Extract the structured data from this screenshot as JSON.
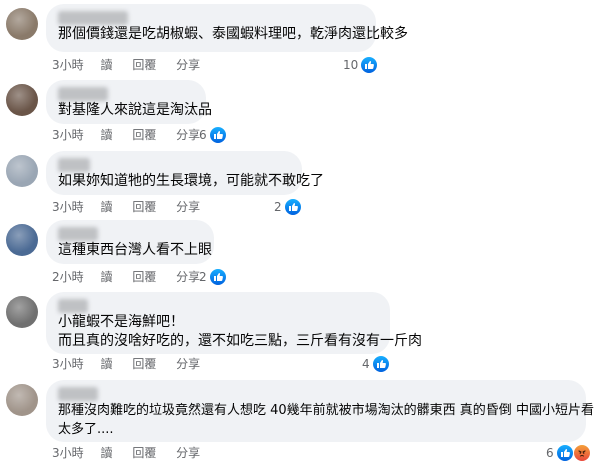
{
  "colors": {
    "bubble": "#f0f2f5",
    "meta_text": "#65676b",
    "body_text": "#050505",
    "like_blue": "#1877f2",
    "angry_orange": "#f0742f"
  },
  "actions": {
    "reply": "讀",
    "hide": "回覆",
    "share": "分享"
  },
  "comments": [
    {
      "avatar_color": "#8a7a6a",
      "time": "3小時",
      "text_lines": [
        "那個價錢還是吃胡椒蝦、泰國蝦料理吧，乾淨肉還比較多"
      ],
      "reactions": {
        "count": "10",
        "icons": [
          "like-icon"
        ]
      }
    },
    {
      "avatar_color": "#6a5548",
      "time": "3小時",
      "text_lines": [
        "對基隆人來說這是淘汰品"
      ],
      "reactions": {
        "count": "6",
        "icons": [
          "like-icon"
        ]
      }
    },
    {
      "avatar_color": "#9aa6b4",
      "time": "3小時",
      "text_lines": [
        "如果妳知道牠的生長環境，可能就不敢吃了"
      ],
      "reactions": {
        "count": "2",
        "icons": [
          "like-icon"
        ]
      }
    },
    {
      "avatar_color": "#4b6a94",
      "time": "2小時",
      "text_lines": [
        "這種東西台灣人看不上眼"
      ],
      "reactions": {
        "count": "2",
        "icons": [
          "like-icon"
        ]
      }
    },
    {
      "avatar_color": "#707070",
      "time": "3小時",
      "text_lines": [
        "小龍蝦不是海鮮吧！",
        "而且真的沒啥好吃的，還不如吃三點，三斤看有沒有一斤肉"
      ],
      "reactions": {
        "count": "4",
        "icons": [
          "like-icon"
        ]
      }
    },
    {
      "avatar_color": "#a0948a",
      "time": "3小時",
      "text_lines": [
        "那種沒肉難吃的垃圾竟然還有人想吃 40幾年前就被市場淘汰的髒東西 真的昏倒 中國小短片看",
        "太多了...."
      ],
      "reactions": {
        "count": "6",
        "icons": [
          "like-icon",
          "angry-icon"
        ]
      }
    }
  ]
}
